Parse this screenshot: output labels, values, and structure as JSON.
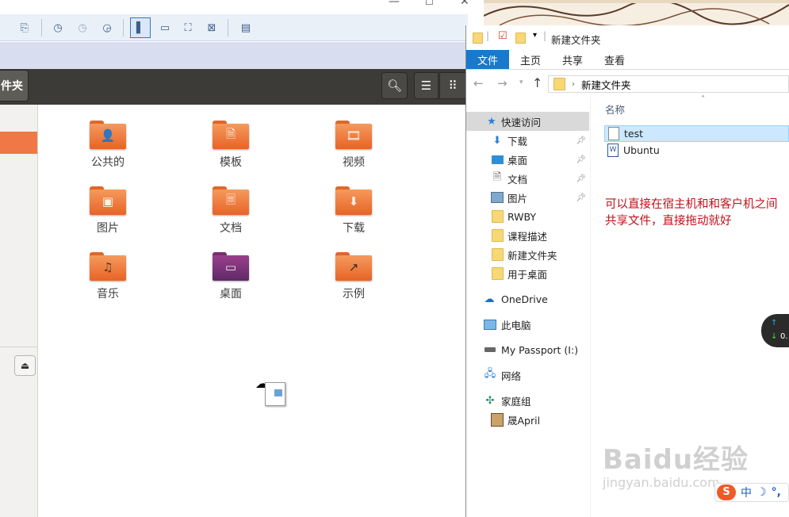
{
  "vm": {
    "toolbar_icons": [
      "snapshot-icon",
      "take-snapshot-icon",
      "revert-snapshot-icon",
      "snapshot-manager-icon",
      "console-view-icon",
      "thumbnail-icon",
      "fullscreen-icon",
      "unity-icon",
      "view-tab-icon"
    ]
  },
  "ubuntu": {
    "path_label": "件夹",
    "folders": [
      {
        "label": "公共的",
        "icon": "public-folder-icon"
      },
      {
        "label": "模板",
        "icon": "templates-folder-icon"
      },
      {
        "label": "视频",
        "icon": "videos-folder-icon"
      },
      {
        "label": "图片",
        "icon": "pictures-folder-icon"
      },
      {
        "label": "文档",
        "icon": "documents-folder-icon"
      },
      {
        "label": "下载",
        "icon": "downloads-folder-icon"
      },
      {
        "label": "音乐",
        "icon": "music-folder-icon"
      },
      {
        "label": "桌面",
        "icon": "desktop-folder-icon"
      },
      {
        "label": "示例",
        "icon": "examples-folder-icon"
      }
    ],
    "accent": "#f07746"
  },
  "explorer": {
    "title": "新建文件夹",
    "tabs": {
      "file": "文件",
      "home": "主页",
      "share": "共享",
      "view": "查看"
    },
    "address": "新建文件夹",
    "column_name": "名称",
    "quick_access": "快速访问",
    "nav": [
      {
        "label": "下载",
        "pinned": true
      },
      {
        "label": "桌面",
        "pinned": true
      },
      {
        "label": "文档",
        "pinned": true
      },
      {
        "label": "图片",
        "pinned": true
      },
      {
        "label": "RWBY",
        "pinned": false
      },
      {
        "label": "课程描述",
        "pinned": false
      },
      {
        "label": "新建文件夹",
        "pinned": false
      },
      {
        "label": "用于桌面",
        "pinned": false
      }
    ],
    "onedrive": "OneDrive",
    "this_pc": "此电脑",
    "passport": "My Passport (I:)",
    "network": "网络",
    "homegroup": "家庭组",
    "user": "晟April",
    "files": [
      {
        "name": "test",
        "selected": true
      },
      {
        "name": "Ubuntu",
        "selected": false
      }
    ],
    "accent": "#1979ca"
  },
  "annotation": "可以直接在宿主机和和客户机之间共享文件，直接拖动就好",
  "widgets": {
    "net_value": "0.",
    "ime_label": "中",
    "watermark_main": "Baidu经验",
    "watermark_sub": "jingyan.baidu.com"
  }
}
